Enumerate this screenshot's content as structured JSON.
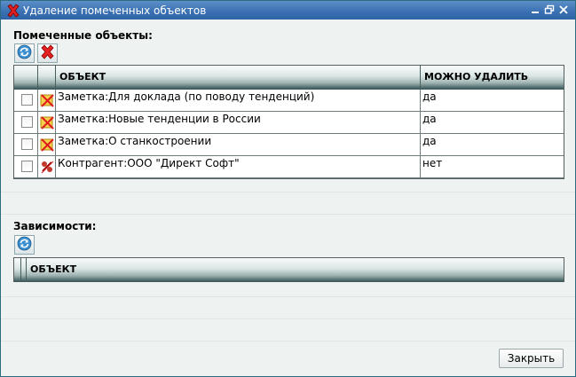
{
  "window": {
    "title": "Удаление помеченных объектов",
    "icon": "delete-x-icon",
    "controls": [
      "minimize-icon",
      "restore-icon",
      "close-icon"
    ]
  },
  "marked": {
    "label": "Помеченные объекты:",
    "toolbar": [
      "refresh-icon",
      "delete-icon"
    ],
    "columns": {
      "object": "ОБЪЕКТ",
      "can_delete": "МОЖНО УДАЛИТЬ"
    },
    "rows": [
      {
        "object": "Заметка:Для доклада (по поводу тенденций)",
        "can_delete": "да",
        "icon": "note-deleted-icon"
      },
      {
        "object": "Заметка:Новые тенденции в России",
        "can_delete": "да",
        "icon": "note-deleted-icon"
      },
      {
        "object": "Заметка:О станкостроении",
        "can_delete": "да",
        "icon": "note-deleted-icon"
      },
      {
        "object": "Контрагент:ООО \"Директ Софт\"",
        "can_delete": "нет",
        "icon": "counterparty-deleted-icon"
      }
    ]
  },
  "dependencies": {
    "label": "Зависимости:",
    "toolbar": [
      "refresh-icon"
    ],
    "columns": {
      "object": "ОБЪЕКТ"
    }
  },
  "footer": {
    "close_label": "Закрыть"
  }
}
